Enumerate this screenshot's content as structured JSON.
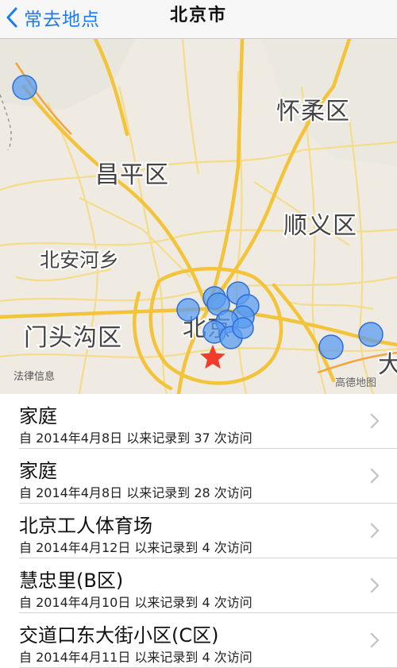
{
  "nav": {
    "back_label": "常去地点",
    "title": "北京市"
  },
  "map": {
    "labels": {
      "huairou": "怀柔区",
      "changping": "昌平区",
      "shunyi": "顺义区",
      "beianhe": "北安河乡",
      "mentougou": "门头沟区",
      "beijing": "北京",
      "partial": "大"
    },
    "legal_label": "法律信息",
    "provider_label": "高德地图",
    "colors": {
      "land": "#efebe3",
      "major_road": "#f3c33a",
      "minor_road": "#f4dc8a",
      "marker_fill": "#5b9cf2",
      "marker_stroke": "#2a6ed8",
      "star": "#f23c2b"
    }
  },
  "list": {
    "items": [
      {
        "title": "家庭",
        "subtitle": "自 2014年4月8日 以来记录到 37 次访问"
      },
      {
        "title": "家庭",
        "subtitle": "自 2014年4月8日 以来记录到 28 次访问"
      },
      {
        "title": "北京工人体育场",
        "subtitle": "自 2014年4月12日 以来记录到 4 次访问"
      },
      {
        "title": "慧忠里(B区)",
        "subtitle": "自 2014年4月10日 以来记录到 4 次访问"
      },
      {
        "title": "交道口东大街小区(C区)",
        "subtitle": "自 2014年4月11日 以来记录到 4 次访问"
      }
    ]
  },
  "icons": {
    "back": "chevron-left-icon",
    "row_disclosure": "chevron-right-icon",
    "location_marker": "location-pin-icon",
    "current_location": "star-icon"
  }
}
